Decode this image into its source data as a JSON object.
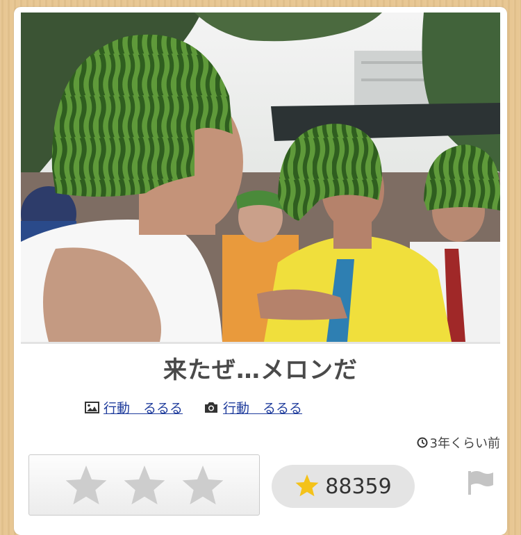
{
  "post": {
    "title": "来たぜ…メロンだ",
    "image_credit": "行動　るるる",
    "photo_credit": "行動　るるる",
    "time_ago": "3年くらい前",
    "score": "88359"
  },
  "rating": {
    "stars": 3
  },
  "colors": {
    "accent_star": "#f4c21a",
    "link": "#1f3c9c"
  }
}
